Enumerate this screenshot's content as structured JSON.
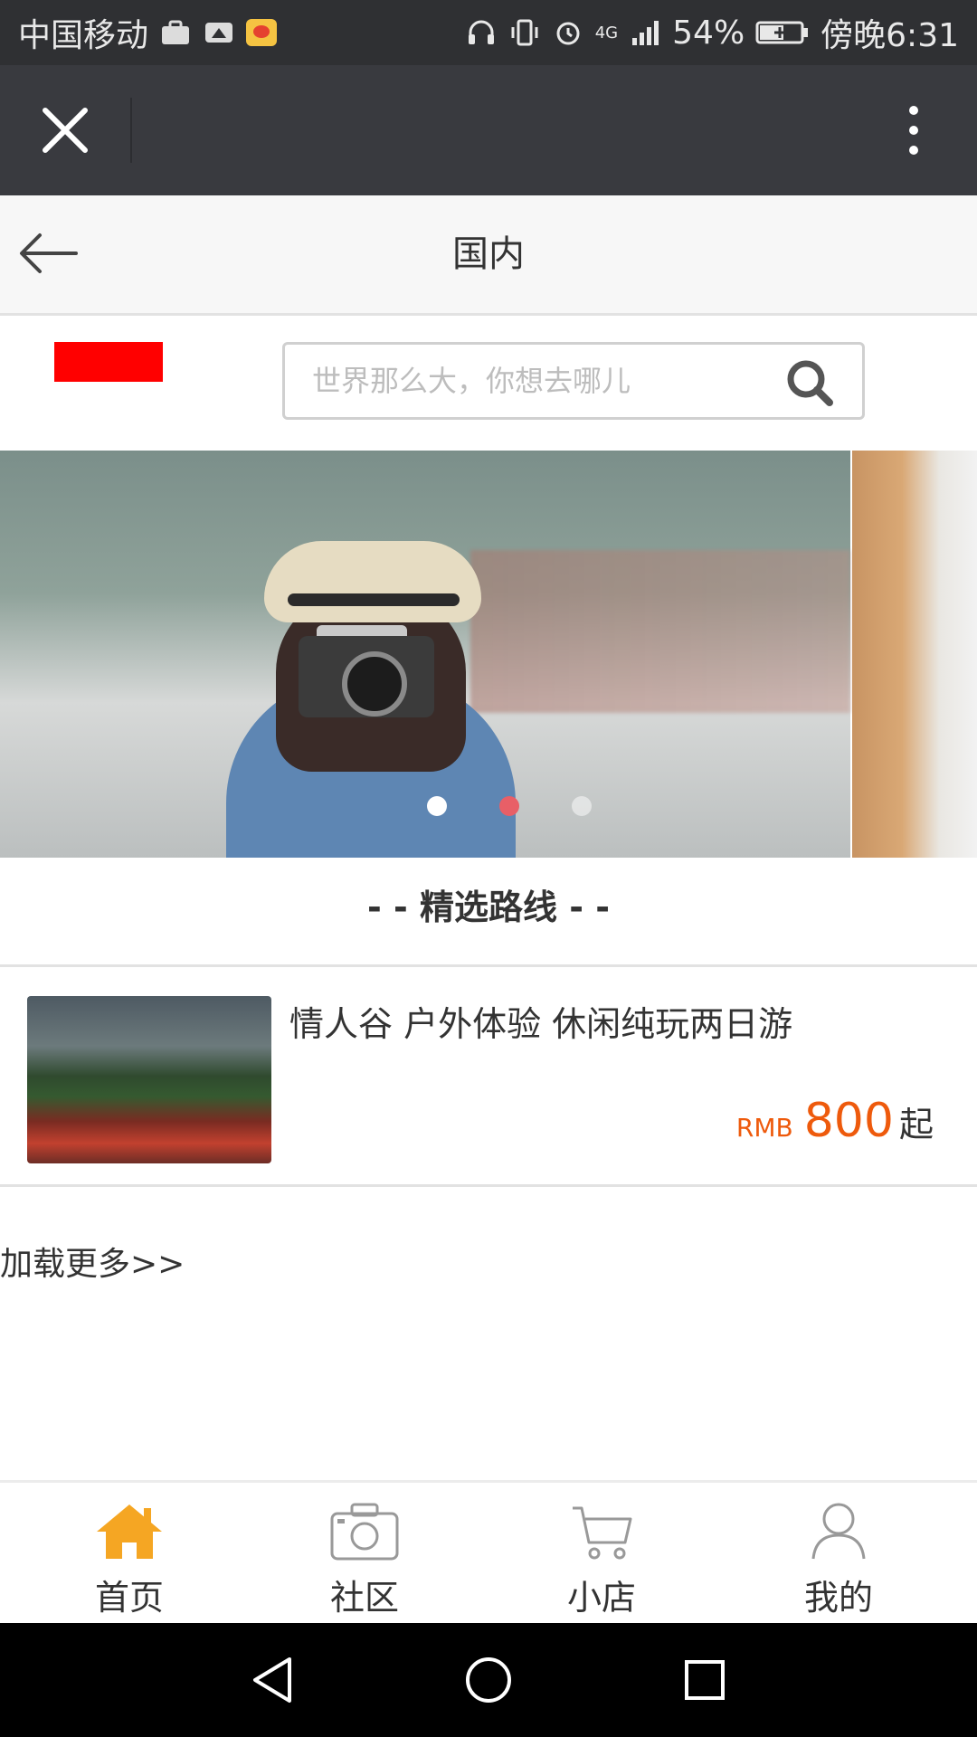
{
  "status_bar": {
    "carrier": "中国移动",
    "battery": "54%",
    "network": "4G",
    "time": "傍晚6:31"
  },
  "webview_toolbar": {
    "close_icon": "close-icon",
    "more_icon": "more-vertical-icon"
  },
  "header": {
    "title": "国内",
    "back_icon": "arrow-left-icon"
  },
  "search": {
    "placeholder": "世界那么大，你想去哪儿",
    "icon": "search-icon"
  },
  "banner": {
    "slide_count": 3,
    "active_index": 1
  },
  "section": {
    "title": "- - 精选路线 - -"
  },
  "routes": [
    {
      "title": "情人谷 户外体验 休闲纯玩两日游",
      "currency": "RMB",
      "price": "800",
      "suffix": "起"
    }
  ],
  "load_more": "加载更多>>",
  "bottom_nav": {
    "items": [
      {
        "label": "首页",
        "icon": "home-icon",
        "active": true
      },
      {
        "label": "社区",
        "icon": "camera-icon",
        "active": false
      },
      {
        "label": "小店",
        "icon": "cart-icon",
        "active": false
      },
      {
        "label": "我的",
        "icon": "user-icon",
        "active": false
      }
    ]
  },
  "colors": {
    "accent_orange": "#ee5a0c",
    "active_tab": "#f5a623",
    "dot_active": "#e85f67",
    "logo_red": "#ff0000"
  }
}
